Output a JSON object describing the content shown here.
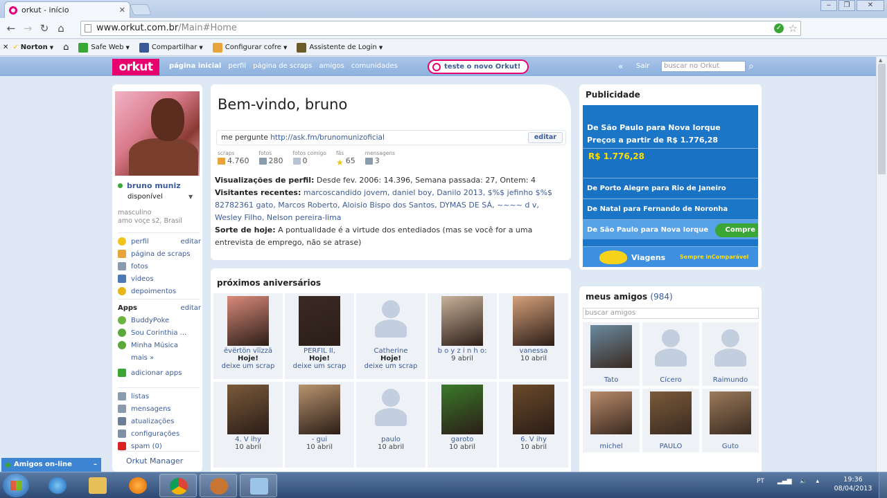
{
  "browser": {
    "tab_title": "orkut - início",
    "url_host": "www.orkut.com.br",
    "url_path": "/Main#Home",
    "bookmarks": [
      {
        "label": "Norton",
        "dropdown": true
      },
      {
        "label": "",
        "dropdown": false
      },
      {
        "label": "Safe Web",
        "dropdown": true
      },
      {
        "label": "Compartilhar",
        "dropdown": true
      },
      {
        "label": "Configurar cofre",
        "dropdown": true
      },
      {
        "label": "Assistente de Login",
        "dropdown": true
      }
    ]
  },
  "orkut_nav": {
    "logo": "orkut",
    "links": [
      "página inicial",
      "perfil",
      "página de scraps",
      "amigos",
      "comunidades"
    ],
    "try_new": "teste o novo Orkut!",
    "back_symbol": "«",
    "logout": "Sair",
    "search_placeholder": "buscar no Orkut"
  },
  "profile": {
    "name": "bruno muniz",
    "status": "disponível",
    "gender": "masculino",
    "details": "amo voçe s2, Brasil",
    "menu": [
      {
        "label": "perfil",
        "edit": "editar",
        "icon": "person-icon",
        "color": "#f0c419"
      },
      {
        "label": "página de scraps",
        "edit": "",
        "icon": "pencil-icon",
        "color": "#e8a33b"
      },
      {
        "label": "fotos",
        "edit": "",
        "icon": "photo-icon",
        "color": "#8a9bb0"
      },
      {
        "label": "vídeos",
        "edit": "",
        "icon": "video-icon",
        "color": "#4a79b5"
      },
      {
        "label": "depoimentos",
        "edit": "",
        "icon": "testimonial-icon",
        "color": "#e8b51b"
      }
    ],
    "apps_title": "Apps",
    "apps_edit": "editar",
    "apps": [
      "BuddyPoke",
      "Sou Corinthia ...",
      "Minha Música"
    ],
    "apps_more": "mais »",
    "add_apps": "adicionar apps",
    "tools": [
      {
        "label": "listas",
        "icon": "list-icon"
      },
      {
        "label": "mensagens",
        "icon": "mail-icon"
      },
      {
        "label": "atualizações",
        "icon": "updates-icon"
      },
      {
        "label": "configurações",
        "icon": "wrench-icon"
      },
      {
        "label": "spam (0)",
        "icon": "spam-icon"
      }
    ],
    "manager": "Orkut Manager"
  },
  "welcome": {
    "title": "Bem-vindo, bruno",
    "ask_label": "me pergunte",
    "ask_link": "http://ask.fm/brunomunizoficial",
    "edit": "editar",
    "stats": [
      {
        "label": "scraps",
        "value": "4.760",
        "color": "#e8a33b"
      },
      {
        "label": "fotos",
        "value": "280",
        "color": "#8a9bb0"
      },
      {
        "label": "fotos comigo",
        "value": "0",
        "color": "#b5c3d4"
      },
      {
        "label": "fãs",
        "value": "65",
        "color": "#f0c419"
      },
      {
        "label": "mensagens",
        "value": "3",
        "color": "#8a9bb0"
      }
    ],
    "views_label": "Visualizações de perfil:",
    "views_text": "Desde fev. 2006: 14.396, Semana passada: 27, Ontem: 4",
    "visitors_label": "Visitantes recentes:",
    "visitors": "marcoscandido jovem, daniel boy, Danilo 2013, $%$ jefinho $%$ 82782361 gato, Marcos Roberto, Aloisio Bispo dos Santos, DYMAS DE SÁ, ~~~~ d v, Wesley Filho, Nelson pereira-lima",
    "luck_label": "Sorte de hoje:",
    "luck_text": "A pontualidade é a virtude dos entediados (mas se você for a uma entrevista de emprego, não se atrase)"
  },
  "birthdays": {
    "title": "próximos aniversários",
    "items": [
      {
        "name": "ëvërtön vïïzzä",
        "date": "Hoje!",
        "action": "deixe um scrap",
        "photo": "photo",
        "today": true
      },
      {
        "name": "PERFIL II,",
        "date": "Hoje!",
        "action": "deixe um scrap",
        "photo": "photo",
        "today": true
      },
      {
        "name": "Catherine",
        "date": "Hoje!",
        "action": "deixe um scrap",
        "photo": "none",
        "today": true
      },
      {
        "name": "b o y z i n h o:",
        "date": "9 abril",
        "action": "",
        "photo": "photo",
        "today": false
      },
      {
        "name": "vanessa",
        "date": "10 abril",
        "action": "",
        "photo": "photo",
        "today": false
      },
      {
        "name": "4.      V ihy",
        "date": "10 abril",
        "action": "",
        "photo": "photo",
        "today": false
      },
      {
        "name": "- gui",
        "date": "10 abril",
        "action": "",
        "photo": "photo",
        "today": false
      },
      {
        "name": "paulo",
        "date": "10 abril",
        "action": "",
        "photo": "none",
        "today": false
      },
      {
        "name": "garoto",
        "date": "10 abril",
        "action": "",
        "photo": "photo",
        "today": false
      },
      {
        "name": "6.      V ihy",
        "date": "10 abril",
        "action": "",
        "photo": "photo",
        "today": false
      }
    ]
  },
  "ad": {
    "title": "Publicidade",
    "line1": "De São Paulo para Nova Iorque",
    "line2": "Preços a partir de R$ 1.776,28",
    "price": "R$ 1.776,28",
    "routes": [
      "De Porto Alegre para Rio de Janeiro",
      "De Natal para Fernando de Noronha",
      "De São Paulo para Nova Iorque"
    ],
    "buy": "Compre",
    "brand": "Viagens",
    "slogan": "Sempre inComparável"
  },
  "friends": {
    "title": "meus amigos",
    "count": "(984)",
    "search_placeholder": "buscar amigos",
    "items": [
      {
        "name": "Tato",
        "photo": "photo"
      },
      {
        "name": "Cícero",
        "photo": "none"
      },
      {
        "name": "Raimundo",
        "photo": "none"
      },
      {
        "name": "michel",
        "photo": "photo"
      },
      {
        "name": "PAULO",
        "photo": "photo"
      },
      {
        "name": "Guto",
        "photo": "photo"
      }
    ]
  },
  "chat": {
    "label": "Amigos on-line",
    "minimize": "–"
  },
  "taskbar": {
    "lang": "PT",
    "time": "19:36",
    "date": "08/04/2013"
  },
  "colors": {
    "orkut_pink": "#e8006f",
    "link_blue": "#3b5b99",
    "page_bg": "#dfe9f6"
  }
}
